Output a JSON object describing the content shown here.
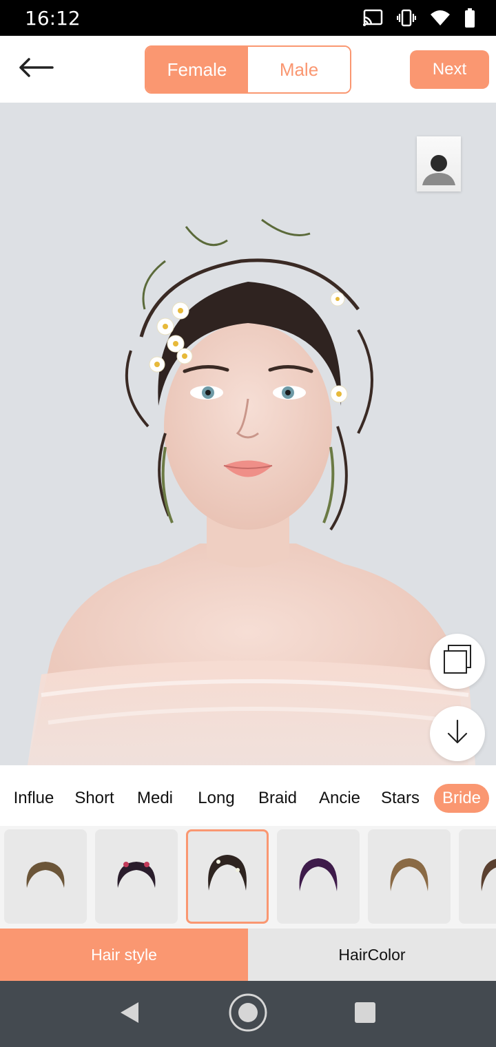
{
  "status_bar": {
    "time": "16:12",
    "icons": [
      "cast-icon",
      "vibrate-icon",
      "wifi-icon",
      "battery-icon"
    ]
  },
  "header": {
    "back_icon": "arrow-left-icon",
    "gender_options": [
      {
        "label": "Female",
        "active": true
      },
      {
        "label": "Male",
        "active": false
      }
    ],
    "next_label": "Next"
  },
  "canvas": {
    "avatar_icon": "person-silhouette-icon",
    "compare_icon": "layers-icon",
    "download_icon": "arrow-down-icon"
  },
  "categories": [
    {
      "label": "Influe",
      "active": false
    },
    {
      "label": "Short",
      "active": false
    },
    {
      "label": "Medi",
      "active": false
    },
    {
      "label": "Long",
      "active": false
    },
    {
      "label": "Braid",
      "active": false
    },
    {
      "label": "Ancie",
      "active": false
    },
    {
      "label": "Stars",
      "active": false
    },
    {
      "label": "Bride",
      "active": true
    }
  ],
  "thumbnails": {
    "selected_index": 2,
    "hair_colors": [
      "#6b5538",
      "#2a1d2c",
      "#2e2420",
      "#3e1b4a",
      "#8a6a45",
      "#5a4030"
    ]
  },
  "bottom_tabs": [
    {
      "label": "Hair style",
      "active": true
    },
    {
      "label": "HairColor",
      "active": false
    }
  ],
  "nav_bar": {
    "icons": [
      "back-triangle-icon",
      "home-circle-icon",
      "recents-square-icon"
    ]
  },
  "colors": {
    "accent": "#fa9771",
    "canvas_background": "#dde0e4",
    "nav_bar": "#444a50"
  }
}
